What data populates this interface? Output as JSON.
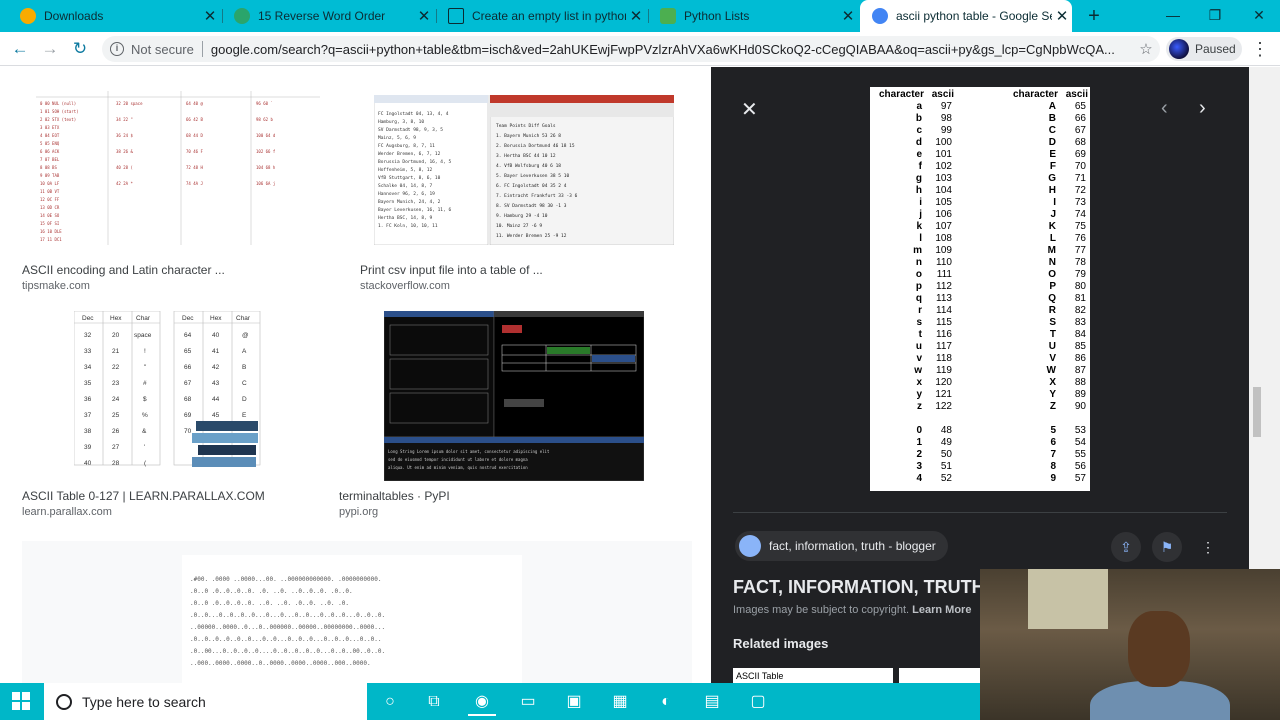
{
  "tabs": [
    {
      "title": "Downloads",
      "color": "#f9ab00"
    },
    {
      "title": "15 Reverse Word Order",
      "color": "#2aa56b"
    },
    {
      "title": "Create an empty list in python",
      "color": "#cc5500"
    },
    {
      "title": "Python Lists",
      "color": "#4caf50"
    },
    {
      "title": "ascii python table - Google Se",
      "color": "#4285f4"
    }
  ],
  "toolbar": {
    "not_secure": "Not secure",
    "url": "google.com/search?q=ascii+python+table&tbm=isch&ved=2ahUKEwjFwpPVzlzrAhVXa6wKHd0SCkoQ2-cCegQIABAA&oq=ascii+py&gs_lcp=CgNpbWcQA...",
    "profile": "Paused"
  },
  "results": [
    {
      "title": "ASCII encoding and Latin character ...",
      "source": "tipsmake.com"
    },
    {
      "title": "Print csv input file into a table of ...",
      "source": "stackoverflow.com"
    },
    {
      "title": "ASCII Table 0-127 | LEARN.PARALLAX.COM",
      "source": "learn.parallax.com"
    },
    {
      "title": "terminaltables · PyPI",
      "source": "pypi.org"
    }
  ],
  "preview": {
    "headers": [
      "character",
      "ascii"
    ],
    "lower": [
      [
        "a",
        "97"
      ],
      [
        "b",
        "98"
      ],
      [
        "c",
        "99"
      ],
      [
        "d",
        "100"
      ],
      [
        "e",
        "101"
      ],
      [
        "f",
        "102"
      ],
      [
        "g",
        "103"
      ],
      [
        "h",
        "104"
      ],
      [
        "i",
        "105"
      ],
      [
        "j",
        "106"
      ],
      [
        "k",
        "107"
      ],
      [
        "l",
        "108"
      ],
      [
        "m",
        "109"
      ],
      [
        "n",
        "110"
      ],
      [
        "o",
        "111"
      ],
      [
        "p",
        "112"
      ],
      [
        "q",
        "113"
      ],
      [
        "r",
        "114"
      ],
      [
        "s",
        "115"
      ],
      [
        "t",
        "116"
      ],
      [
        "u",
        "117"
      ],
      [
        "v",
        "118"
      ],
      [
        "w",
        "119"
      ],
      [
        "x",
        "120"
      ],
      [
        "y",
        "121"
      ],
      [
        "z",
        "122"
      ]
    ],
    "upper": [
      [
        "A",
        "65"
      ],
      [
        "B",
        "66"
      ],
      [
        "C",
        "67"
      ],
      [
        "D",
        "68"
      ],
      [
        "E",
        "69"
      ],
      [
        "F",
        "70"
      ],
      [
        "G",
        "71"
      ],
      [
        "H",
        "72"
      ],
      [
        "I",
        "73"
      ],
      [
        "J",
        "74"
      ],
      [
        "K",
        "75"
      ],
      [
        "L",
        "76"
      ],
      [
        "M",
        "77"
      ],
      [
        "N",
        "78"
      ],
      [
        "O",
        "79"
      ],
      [
        "P",
        "80"
      ],
      [
        "Q",
        "81"
      ],
      [
        "R",
        "82"
      ],
      [
        "S",
        "83"
      ],
      [
        "T",
        "84"
      ],
      [
        "U",
        "85"
      ],
      [
        "V",
        "86"
      ],
      [
        "W",
        "87"
      ],
      [
        "X",
        "88"
      ],
      [
        "Y",
        "89"
      ],
      [
        "Z",
        "90"
      ]
    ],
    "digits_left": [
      [
        "0",
        "48"
      ],
      [
        "1",
        "49"
      ],
      [
        "2",
        "50"
      ],
      [
        "3",
        "51"
      ],
      [
        "4",
        "52"
      ]
    ],
    "digits_right": [
      [
        "5",
        "53"
      ],
      [
        "6",
        "54"
      ],
      [
        "7",
        "55"
      ],
      [
        "8",
        "56"
      ],
      [
        "9",
        "57"
      ]
    ]
  },
  "panel": {
    "source": "fact, information, truth - blogger",
    "title": "FACT, INFORMATION, TRUTH:",
    "copyright": "Images may be subject to copyright.",
    "learn_more": "Learn More",
    "related": "Related images",
    "related_thumb": "ASCII Table"
  },
  "taskbar": {
    "search_placeholder": "Type here to search"
  },
  "icons": {
    "close": "close-icon",
    "back": "back-arrow-icon",
    "forward": "forward-arrow-icon",
    "reload": "reload-icon",
    "star": "star-icon",
    "share": "share-icon",
    "bookmark": "bookmark-icon"
  }
}
